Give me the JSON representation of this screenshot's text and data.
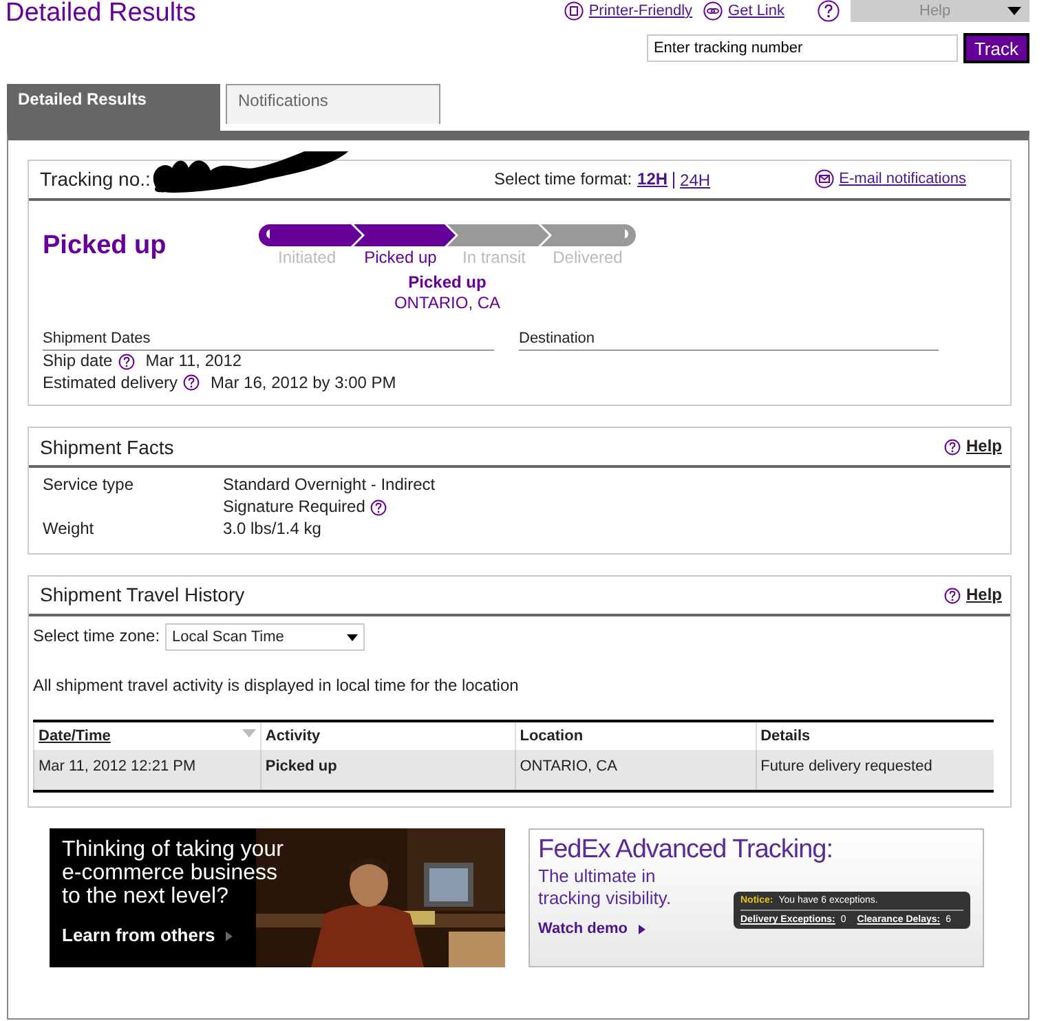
{
  "page_title": "Detailed Results",
  "header_links": [
    {
      "label": "Printer-Friendly",
      "kind": "printer"
    },
    {
      "label": "Get Link",
      "kind": "link"
    }
  ],
  "help_menu": {
    "label": "Help"
  },
  "tracking_search": {
    "value": "Enter tracking number",
    "button": "Track"
  },
  "tabs": [
    {
      "label": "Detailed Results",
      "selected": true
    },
    {
      "label": "Notifications",
      "selected": false
    }
  ],
  "tracking": {
    "label": "Tracking no.:",
    "time_format_label": "Select time format:",
    "time_formats": [
      {
        "label": "12H",
        "selected": true
      },
      {
        "label": "24H",
        "selected": false
      }
    ],
    "email_link": "E-mail notifications"
  },
  "status": {
    "title": "Picked up",
    "steps": [
      {
        "label": "Initiated",
        "reached": true,
        "current": false
      },
      {
        "label": "Picked up",
        "reached": true,
        "current": true
      },
      {
        "label": "In transit",
        "reached": false,
        "current": false
      },
      {
        "label": "Delivered",
        "reached": false,
        "current": false
      }
    ],
    "event": "Picked up",
    "location": "ONTARIO, CA"
  },
  "dates": {
    "heading": "Shipment Dates",
    "rows": [
      {
        "label": "Ship date",
        "help": true,
        "value": "Mar 11, 2012"
      },
      {
        "label": "Estimated delivery",
        "help": true,
        "value": "Mar 16, 2012 by 3:00 PM"
      }
    ]
  },
  "destination": {
    "heading": "Destination"
  },
  "facts": {
    "title": "Shipment Facts",
    "help": "Help",
    "rows": [
      {
        "label": "Service type",
        "lines": [
          {
            "text": "Standard Overnight - Indirect",
            "help": false
          },
          {
            "text": "Signature Required",
            "help": true
          }
        ]
      },
      {
        "label": "Weight",
        "lines": [
          {
            "text": "3.0 lbs/1.4 kg",
            "help": false
          }
        ]
      }
    ]
  },
  "history": {
    "title": "Shipment Travel History",
    "help": "Help",
    "timezone_label": "Select time zone:",
    "timezone": "Local Scan Time",
    "note": "All shipment travel activity is displayed in local time for the location",
    "columns": [
      {
        "label": "Date/Time",
        "sortable": true,
        "emphasis": false
      },
      {
        "label": "Activity",
        "sortable": false,
        "emphasis": true
      },
      {
        "label": "Location",
        "sortable": false,
        "emphasis": false
      },
      {
        "label": "Details",
        "sortable": false,
        "emphasis": false
      }
    ],
    "rows": [
      [
        "Mar 11, 2012 12:21 PM",
        "Picked up",
        "ONTARIO, CA",
        "Future delivery requested"
      ]
    ]
  },
  "ads": [
    {
      "lines": [
        "Thinking of taking your",
        "e-commerce business",
        "to the next level?"
      ],
      "link": "Learn from others"
    },
    {
      "kind": "demo",
      "title": "FedEx Advanced Tracking:",
      "lines": [
        "The ultimate in",
        "tracking visibility."
      ],
      "link": "Watch demo",
      "notice": {
        "label": "Notice:",
        "text": "You have 6 exceptions.",
        "stats": [
          {
            "label": "Delivery Exceptions:",
            "value": "0"
          },
          {
            "label": "Clearance Delays:",
            "value": "6"
          }
        ]
      }
    }
  ]
}
